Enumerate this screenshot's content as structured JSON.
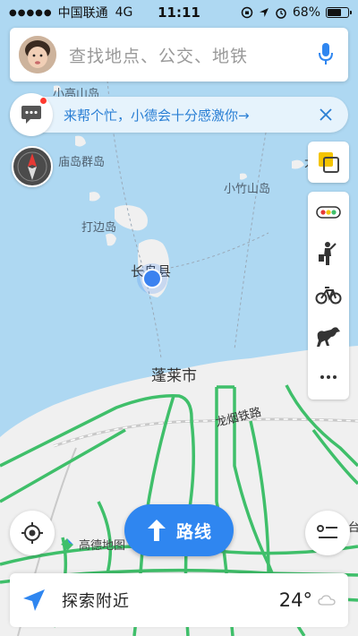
{
  "status_bar": {
    "signal": "●●●●●",
    "carrier": "中国联通",
    "network": "4G",
    "time": "11:11",
    "battery_percent": "68%",
    "battery_level": 0.68
  },
  "search": {
    "placeholder": "查找地点、公交、地铁"
  },
  "notice": {
    "text": "来帮个忙，小德会十分感激你→"
  },
  "map": {
    "labels": {
      "xiaogaoshan": "小高山岛",
      "miaodao": "庙岛群岛",
      "xiaozhushan": "小竹山岛",
      "dabian": "打边岛",
      "changdao": "长岛县",
      "penglai": "蓬莱市",
      "longyan": "龙烟铁路",
      "edge_right": "大",
      "edge_right_bottom": "台"
    }
  },
  "buttons": {
    "route_label": "路线"
  },
  "brand": {
    "text": "高德地图"
  },
  "explore": {
    "label": "探索附近",
    "temperature": "24°"
  },
  "colors": {
    "accent": "#2f86f0",
    "water": "#aed8f2",
    "land": "#f0f0f0",
    "road": "#3fbf6a"
  }
}
